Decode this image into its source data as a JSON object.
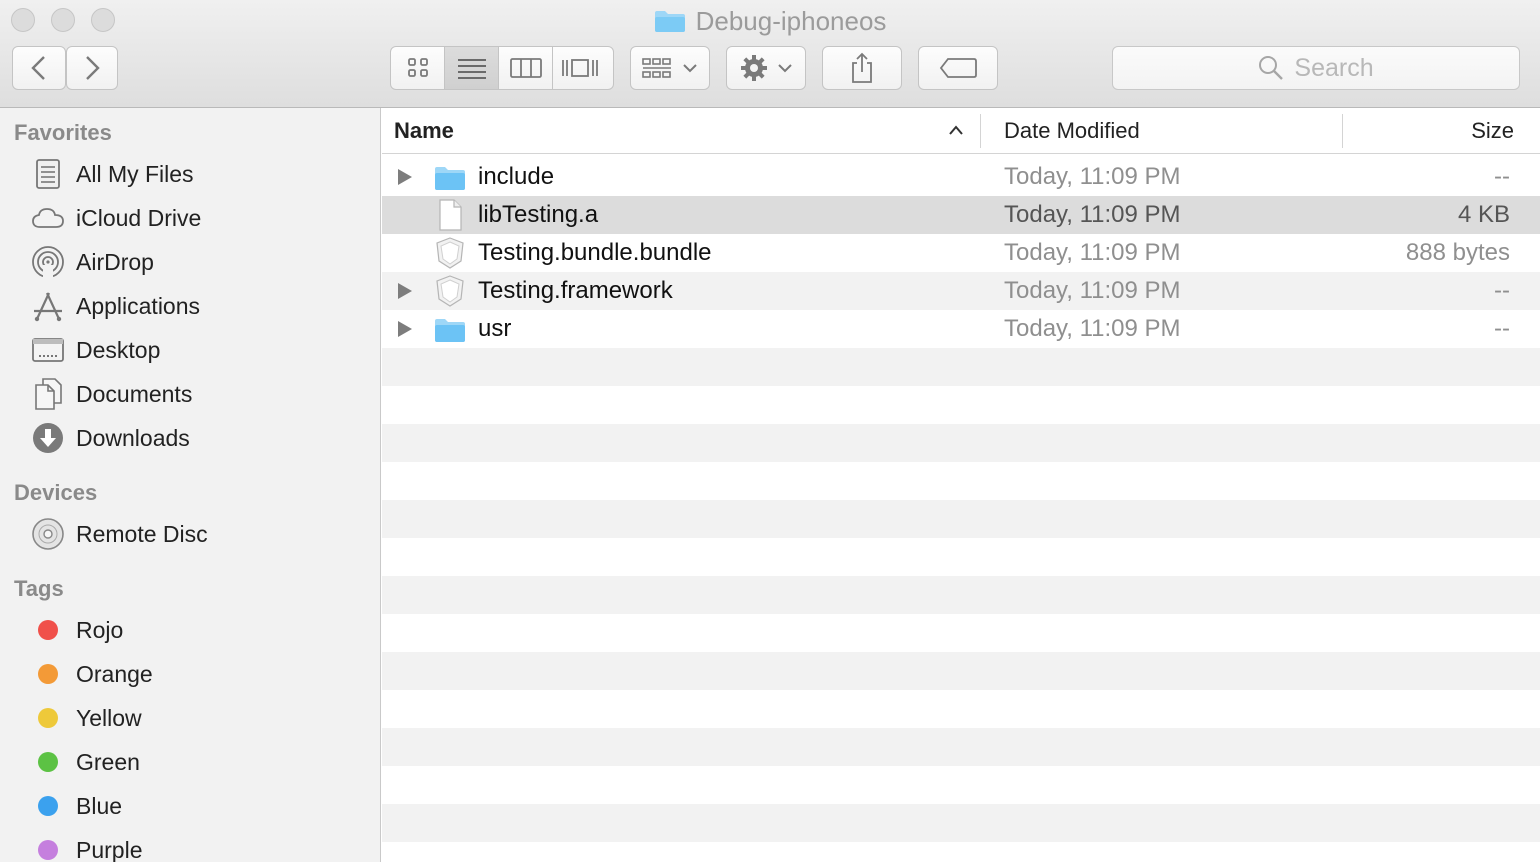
{
  "window": {
    "title": "Debug-iphoneos"
  },
  "toolbar": {
    "back_icon": "chevron-left-icon",
    "forward_icon": "chevron-right-icon",
    "view_modes": [
      "icon-view",
      "list-view",
      "column-view",
      "cover-flow-view"
    ],
    "active_view": "list-view",
    "search_placeholder": "Search"
  },
  "sidebar": {
    "favorites_header": "Favorites",
    "favorites": [
      {
        "label": "All My Files",
        "icon": "all-files-icon"
      },
      {
        "label": "iCloud Drive",
        "icon": "cloud-icon"
      },
      {
        "label": "AirDrop",
        "icon": "airdrop-icon"
      },
      {
        "label": "Applications",
        "icon": "applications-icon"
      },
      {
        "label": "Desktop",
        "icon": "desktop-icon"
      },
      {
        "label": "Documents",
        "icon": "documents-icon"
      },
      {
        "label": "Downloads",
        "icon": "downloads-icon"
      }
    ],
    "devices_header": "Devices",
    "devices": [
      {
        "label": "Remote Disc",
        "icon": "disc-icon"
      }
    ],
    "tags_header": "Tags",
    "tags": [
      {
        "label": "Rojo",
        "color": "#f0504a"
      },
      {
        "label": "Orange",
        "color": "#f39a37"
      },
      {
        "label": "Yellow",
        "color": "#eec93a"
      },
      {
        "label": "Green",
        "color": "#5cc244"
      },
      {
        "label": "Blue",
        "color": "#3ba1ee"
      },
      {
        "label": "Purple",
        "color": "#c57fde"
      }
    ]
  },
  "columns": {
    "name": "Name",
    "date_modified": "Date Modified",
    "size": "Size"
  },
  "files": [
    {
      "name": "include",
      "date": "Today, 11:09 PM",
      "size": "--",
      "type": "folder",
      "expandable": true,
      "selected": false
    },
    {
      "name": "libTesting.a",
      "date": "Today, 11:09 PM",
      "size": "4 KB",
      "type": "document",
      "expandable": false,
      "selected": true
    },
    {
      "name": "Testing.bundle.bundle",
      "date": "Today, 11:09 PM",
      "size": "888 bytes",
      "type": "bundle",
      "expandable": false,
      "selected": false
    },
    {
      "name": "Testing.framework",
      "date": "Today, 11:09 PM",
      "size": "--",
      "type": "bundle",
      "expandable": true,
      "selected": false
    },
    {
      "name": "usr",
      "date": "Today, 11:09 PM",
      "size": "--",
      "type": "folder",
      "expandable": true,
      "selected": false
    }
  ],
  "colors": {
    "folder": "#6cc3f5",
    "selection": "#dcdcdc",
    "sidebar_bg": "#f2f2f2"
  }
}
